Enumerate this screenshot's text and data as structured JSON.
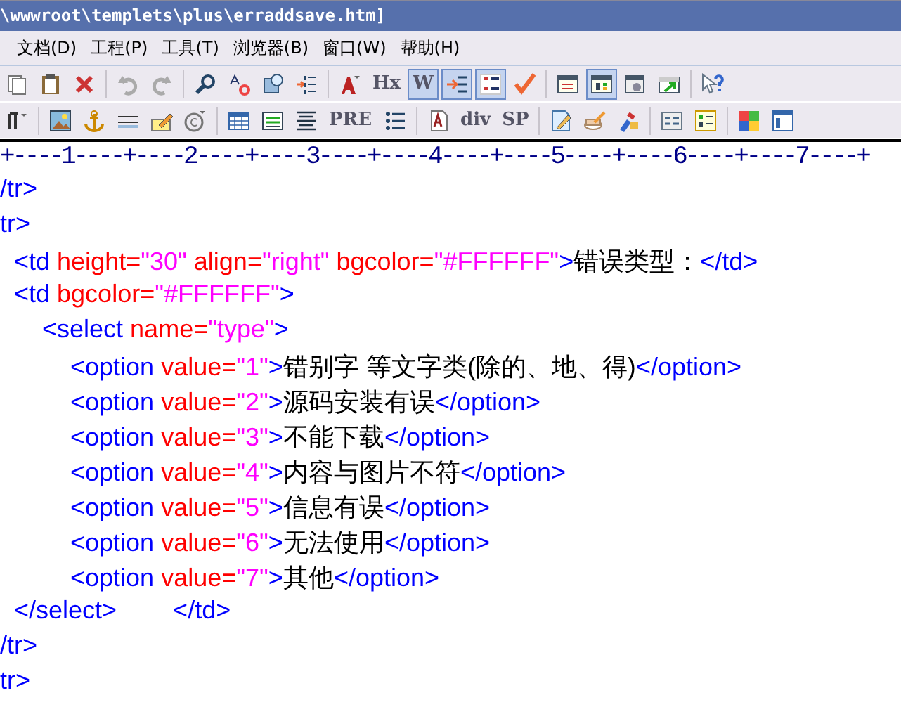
{
  "window": {
    "title": "\\wwwroot\\templets\\plus\\erraddsave.htm]"
  },
  "menu": [
    {
      "label": "文档(D)"
    },
    {
      "label": "工程(P)"
    },
    {
      "label": "工具(T)"
    },
    {
      "label": "浏览器(B)"
    },
    {
      "label": "窗口(W)"
    },
    {
      "label": "帮助(H)"
    }
  ],
  "toolbar_1": [
    {
      "kind": "icon",
      "selected": false
    },
    {
      "kind": "icon",
      "selected": false
    },
    {
      "kind": "icon",
      "selected": false
    },
    {
      "kind": "separator"
    },
    {
      "kind": "icon",
      "selected": false
    },
    {
      "kind": "icon",
      "selected": false
    },
    {
      "kind": "separator"
    },
    {
      "kind": "icon",
      "selected": false
    },
    {
      "kind": "icon",
      "selected": false
    },
    {
      "kind": "icon",
      "selected": false
    },
    {
      "kind": "icon",
      "selected": false
    },
    {
      "kind": "separator"
    },
    {
      "kind": "icon",
      "selected": false
    },
    {
      "kind": "text",
      "label": "Hx",
      "selected": false
    },
    {
      "kind": "text",
      "label": "W",
      "selected": true
    },
    {
      "kind": "icon",
      "selected": true
    },
    {
      "kind": "icon",
      "selected": true
    },
    {
      "kind": "icon",
      "selected": false
    },
    {
      "kind": "separator"
    },
    {
      "kind": "icon",
      "selected": false
    },
    {
      "kind": "icon",
      "selected": true
    },
    {
      "kind": "icon",
      "selected": false
    },
    {
      "kind": "icon",
      "selected": false
    },
    {
      "kind": "separator"
    },
    {
      "kind": "icon",
      "selected": false
    }
  ],
  "toolbar_2": [
    {
      "kind": "icon",
      "selected": false
    },
    {
      "kind": "separator"
    },
    {
      "kind": "icon",
      "selected": false
    },
    {
      "kind": "icon",
      "selected": false
    },
    {
      "kind": "icon",
      "selected": false
    },
    {
      "kind": "icon",
      "selected": false
    },
    {
      "kind": "icon",
      "selected": false
    },
    {
      "kind": "separator"
    },
    {
      "kind": "icon",
      "selected": false
    },
    {
      "kind": "icon",
      "selected": false
    },
    {
      "kind": "icon",
      "selected": false
    },
    {
      "kind": "text",
      "label": "PRE",
      "selected": false
    },
    {
      "kind": "icon",
      "selected": false
    },
    {
      "kind": "separator"
    },
    {
      "kind": "icon",
      "selected": false
    },
    {
      "kind": "text",
      "label": "div",
      "selected": false
    },
    {
      "kind": "text",
      "label": "SP",
      "selected": false
    },
    {
      "kind": "separator"
    },
    {
      "kind": "icon",
      "selected": false
    },
    {
      "kind": "icon",
      "selected": false
    },
    {
      "kind": "icon",
      "selected": false
    },
    {
      "kind": "separator"
    },
    {
      "kind": "icon",
      "selected": false
    },
    {
      "kind": "icon",
      "selected": false
    },
    {
      "kind": "separator"
    },
    {
      "kind": "icon",
      "selected": false
    },
    {
      "kind": "icon",
      "selected": false
    }
  ],
  "ruler": "+----1----+----2----+----3----+----4----+----5----+----6----+----7----+",
  "code_lines": [
    {
      "tokens": [
        {
          "kind": "tag",
          "text": "/tr>"
        }
      ]
    },
    {
      "tokens": [
        {
          "kind": "tag",
          "text": "tr>"
        }
      ]
    },
    {
      "tokens": [
        {
          "kind": "tag",
          "text": "  <td"
        },
        {
          "kind": "attr",
          "text": " height="
        },
        {
          "kind": "value",
          "text": "\"30\""
        },
        {
          "kind": "attr",
          "text": " align="
        },
        {
          "kind": "value",
          "text": "\"right\""
        },
        {
          "kind": "attr",
          "text": " bgcolor="
        },
        {
          "kind": "value",
          "text": "\"#FFFFFF\""
        },
        {
          "kind": "tag",
          "text": ">"
        },
        {
          "kind": "plain",
          "text": "错误类型："
        },
        {
          "kind": "tag",
          "text": "</td>"
        }
      ]
    },
    {
      "tokens": [
        {
          "kind": "tag",
          "text": "  <td"
        },
        {
          "kind": "attr",
          "text": " bgcolor="
        },
        {
          "kind": "value",
          "text": "\"#FFFFFF\""
        },
        {
          "kind": "tag",
          "text": ">"
        }
      ]
    },
    {
      "tokens": [
        {
          "kind": "tag",
          "text": "      <select"
        },
        {
          "kind": "attr",
          "text": " name="
        },
        {
          "kind": "value",
          "text": "\"type\""
        },
        {
          "kind": "tag",
          "text": ">"
        }
      ]
    },
    {
      "tokens": [
        {
          "kind": "tag",
          "text": "          <option"
        },
        {
          "kind": "attr",
          "text": " value="
        },
        {
          "kind": "value",
          "text": "\"1\""
        },
        {
          "kind": "tag",
          "text": ">"
        },
        {
          "kind": "plain",
          "text": "错别字 等文字类(除的、地、得)"
        },
        {
          "kind": "tag",
          "text": "</option>"
        }
      ]
    },
    {
      "tokens": [
        {
          "kind": "tag",
          "text": "          <option"
        },
        {
          "kind": "attr",
          "text": " value="
        },
        {
          "kind": "value",
          "text": "\"2\""
        },
        {
          "kind": "tag",
          "text": ">"
        },
        {
          "kind": "plain",
          "text": "源码安装有误"
        },
        {
          "kind": "tag",
          "text": "</option>"
        }
      ]
    },
    {
      "tokens": [
        {
          "kind": "tag",
          "text": "          <option"
        },
        {
          "kind": "attr",
          "text": " value="
        },
        {
          "kind": "value",
          "text": "\"3\""
        },
        {
          "kind": "tag",
          "text": ">"
        },
        {
          "kind": "plain",
          "text": "不能下载"
        },
        {
          "kind": "tag",
          "text": "</option>"
        }
      ]
    },
    {
      "tokens": [
        {
          "kind": "tag",
          "text": "          <option"
        },
        {
          "kind": "attr",
          "text": " value="
        },
        {
          "kind": "value",
          "text": "\"4\""
        },
        {
          "kind": "tag",
          "text": ">"
        },
        {
          "kind": "plain",
          "text": "内容与图片不符"
        },
        {
          "kind": "tag",
          "text": "</option>"
        }
      ]
    },
    {
      "tokens": [
        {
          "kind": "tag",
          "text": "          <option"
        },
        {
          "kind": "attr",
          "text": " value="
        },
        {
          "kind": "value",
          "text": "\"5\""
        },
        {
          "kind": "tag",
          "text": ">"
        },
        {
          "kind": "plain",
          "text": "信息有误"
        },
        {
          "kind": "tag",
          "text": "</option>"
        }
      ]
    },
    {
      "tokens": [
        {
          "kind": "tag",
          "text": "          <option"
        },
        {
          "kind": "attr",
          "text": " value="
        },
        {
          "kind": "value",
          "text": "\"6\""
        },
        {
          "kind": "tag",
          "text": ">"
        },
        {
          "kind": "plain",
          "text": "无法使用"
        },
        {
          "kind": "tag",
          "text": "</option>"
        }
      ]
    },
    {
      "tokens": [
        {
          "kind": "tag",
          "text": "          <option"
        },
        {
          "kind": "attr",
          "text": " value="
        },
        {
          "kind": "value",
          "text": "\"7\""
        },
        {
          "kind": "tag",
          "text": ">"
        },
        {
          "kind": "plain",
          "text": "其他"
        },
        {
          "kind": "tag",
          "text": "</option>"
        }
      ]
    },
    {
      "tokens": [
        {
          "kind": "tag",
          "text": "  </select>        </td>"
        }
      ]
    },
    {
      "tokens": [
        {
          "kind": "tag",
          "text": "/tr>"
        }
      ]
    },
    {
      "tokens": [
        {
          "kind": "tag",
          "text": "tr>"
        }
      ]
    }
  ]
}
